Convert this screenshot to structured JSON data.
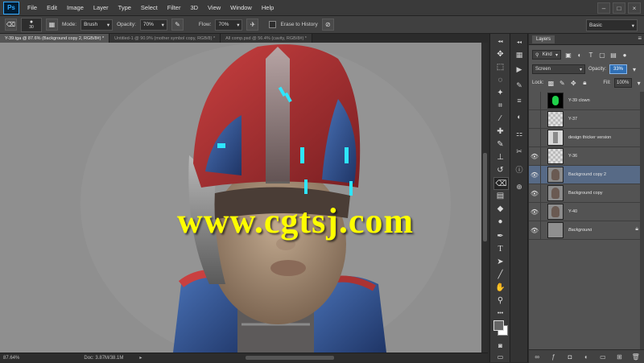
{
  "app": {
    "logo": "Ps"
  },
  "menu": [
    "File",
    "Edit",
    "Image",
    "Layer",
    "Type",
    "Select",
    "Filter",
    "3D",
    "View",
    "Window",
    "Help"
  ],
  "window_controls": {
    "minimize": "–",
    "maximize": "□",
    "close": "×"
  },
  "options_bar": {
    "brush_size": "30",
    "mode_label": "Mode:",
    "mode_value": "Brush",
    "opacity_label": "Opacity:",
    "opacity_value": "70%",
    "flow_label": "Flow:",
    "flow_value": "70%",
    "erase_history_label": "Erase to History",
    "workspace": "Basic"
  },
  "tabs": [
    {
      "label": "Y-39.tga @ 87.6% (Background copy 2, RGB/8#) *",
      "active": true
    },
    {
      "label": "Untitled-1 @ 90.9% (mother symbol copy, RGB/8) *",
      "active": false
    },
    {
      "label": "All comp.psd @ 56.4% (cavity, RGB/8#) *",
      "active": false
    }
  ],
  "canvas": {
    "watermark": "www.cgtsj.com"
  },
  "status": {
    "zoom": "87.64%",
    "doc": "Doc: 3.87M/38.1M"
  },
  "layers_panel": {
    "tab": "Layers",
    "filter_kind": "Kind",
    "blend_mode": "Screen",
    "opacity_label": "Opacity:",
    "opacity_value": "33%",
    "lock_label": "Lock:",
    "fill_label": "Fill:",
    "fill_value": "100%",
    "layers": [
      {
        "name": "Y-39 clown",
        "visible": false,
        "selected": false,
        "italic": false,
        "thumb": "clown"
      },
      {
        "name": "Y-37",
        "visible": false,
        "selected": false,
        "italic": false,
        "thumb": "transparent"
      },
      {
        "name": "design thicker version",
        "visible": false,
        "selected": false,
        "italic": false,
        "thumb": "sketch"
      },
      {
        "name": "Y-36",
        "visible": true,
        "selected": false,
        "italic": false,
        "thumb": "transparent"
      },
      {
        "name": "Background copy 2",
        "visible": true,
        "selected": true,
        "italic": false,
        "thumb": "head"
      },
      {
        "name": "Background copy",
        "visible": true,
        "selected": false,
        "italic": false,
        "thumb": "head"
      },
      {
        "name": "Y-40",
        "visible": true,
        "selected": false,
        "italic": false,
        "thumb": "head"
      },
      {
        "name": "Background",
        "visible": true,
        "selected": false,
        "italic": true,
        "thumb": "gray",
        "locked": true
      }
    ]
  },
  "colors": {
    "accent": "#31a8ff",
    "selected_layer": "#576a86",
    "watermark": "#ffff00"
  }
}
